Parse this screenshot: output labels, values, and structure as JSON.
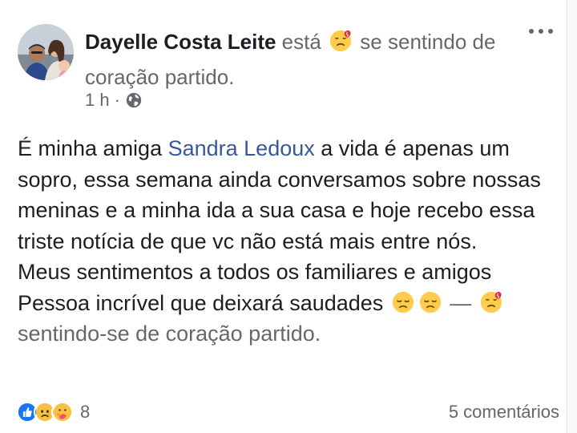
{
  "post": {
    "author": "Dayelle Costa Leite",
    "feeling_prefix": "está",
    "feeling_suffix": "se sentindo de coração partido.",
    "time": "1 h",
    "time_separator": "·",
    "privacy_icon": "globe-icon",
    "more_icon": "more-options-icon",
    "mentioned_user": "Sandra Ledoux",
    "body": {
      "before_mention": "É minha amiga ",
      "after_mention": " a vida é apenas um sopro, essa semana ainda conversamos sobre nossas meninas e a minha ida a sua casa e hoje recebo essa triste notícia de que vc não está mais entre nós.",
      "line2": "Meus sentimentos a todos os familiares e amigos",
      "line3": "Pessoa incrível que deixará saudades",
      "dash": " — ",
      "feeling_line": "sentindo-se de coração partido."
    },
    "emojis": {
      "header_feeling": "broken-heart-face-icon",
      "sad1": "disappointed-face-icon",
      "sad2": "disappointed-face-icon",
      "inline_feeling": "broken-heart-face-icon"
    }
  },
  "footer": {
    "reactions": [
      "like-icon",
      "sad-face-icon",
      "care-icon"
    ],
    "reaction_count": "8",
    "comments_label": "5 comentários"
  },
  "colors": {
    "link": "#385898",
    "secondary_text": "#65676b",
    "primary_text": "#1c1e21",
    "like_blue": "#1877f2"
  }
}
